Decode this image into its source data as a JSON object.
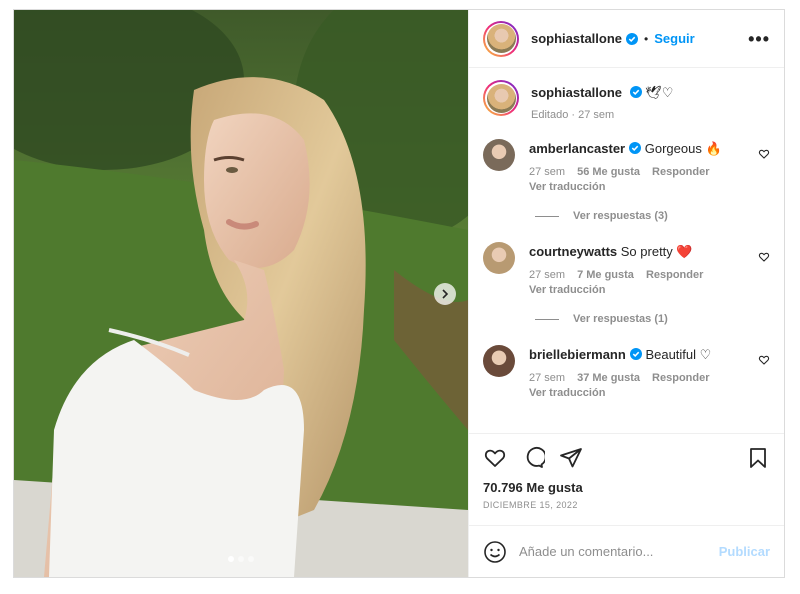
{
  "post": {
    "author": "sophiastallone",
    "follow_label": "Seguir",
    "separator": "•",
    "more_label": "•••",
    "caption_emoji": "🕊♡",
    "caption_meta": "Editado · 27 sem",
    "carousel": {
      "slides": 3,
      "active_index": 0
    }
  },
  "comments": [
    {
      "user": "amberlancaster",
      "verified": true,
      "text": "Gorgeous 🔥",
      "time": "27 sem",
      "likes": "56 Me gusta",
      "reply_label": "Responder",
      "translate_label": "Ver traducción",
      "replies_label": "Ver respuestas (3)",
      "avatar_color": "#7a6a5a"
    },
    {
      "user": "courtneywatts",
      "verified": false,
      "text": "So pretty ❤️",
      "time": "27 sem",
      "likes": "7 Me gusta",
      "reply_label": "Responder",
      "translate_label": "Ver traducción",
      "replies_label": "Ver respuestas (1)",
      "avatar_color": "#b89a72"
    },
    {
      "user": "briellebiermann",
      "verified": true,
      "text": "Beautiful ♡",
      "time": "27 sem",
      "likes": "37 Me gusta",
      "reply_label": "Responder",
      "translate_label": "Ver traducción",
      "replies_label": "",
      "avatar_color": "#6a4a3a"
    }
  ],
  "footer": {
    "likes": "70.796 Me gusta",
    "date": "DICIEMBRE 15, 2022",
    "comment_placeholder": "Añade un comentario...",
    "publish_label": "Publicar"
  },
  "colors": {
    "accent": "#0095f6",
    "verified": "#0095f6",
    "muted": "#8e8e8e",
    "publish_disabled": "#b3dbff"
  }
}
